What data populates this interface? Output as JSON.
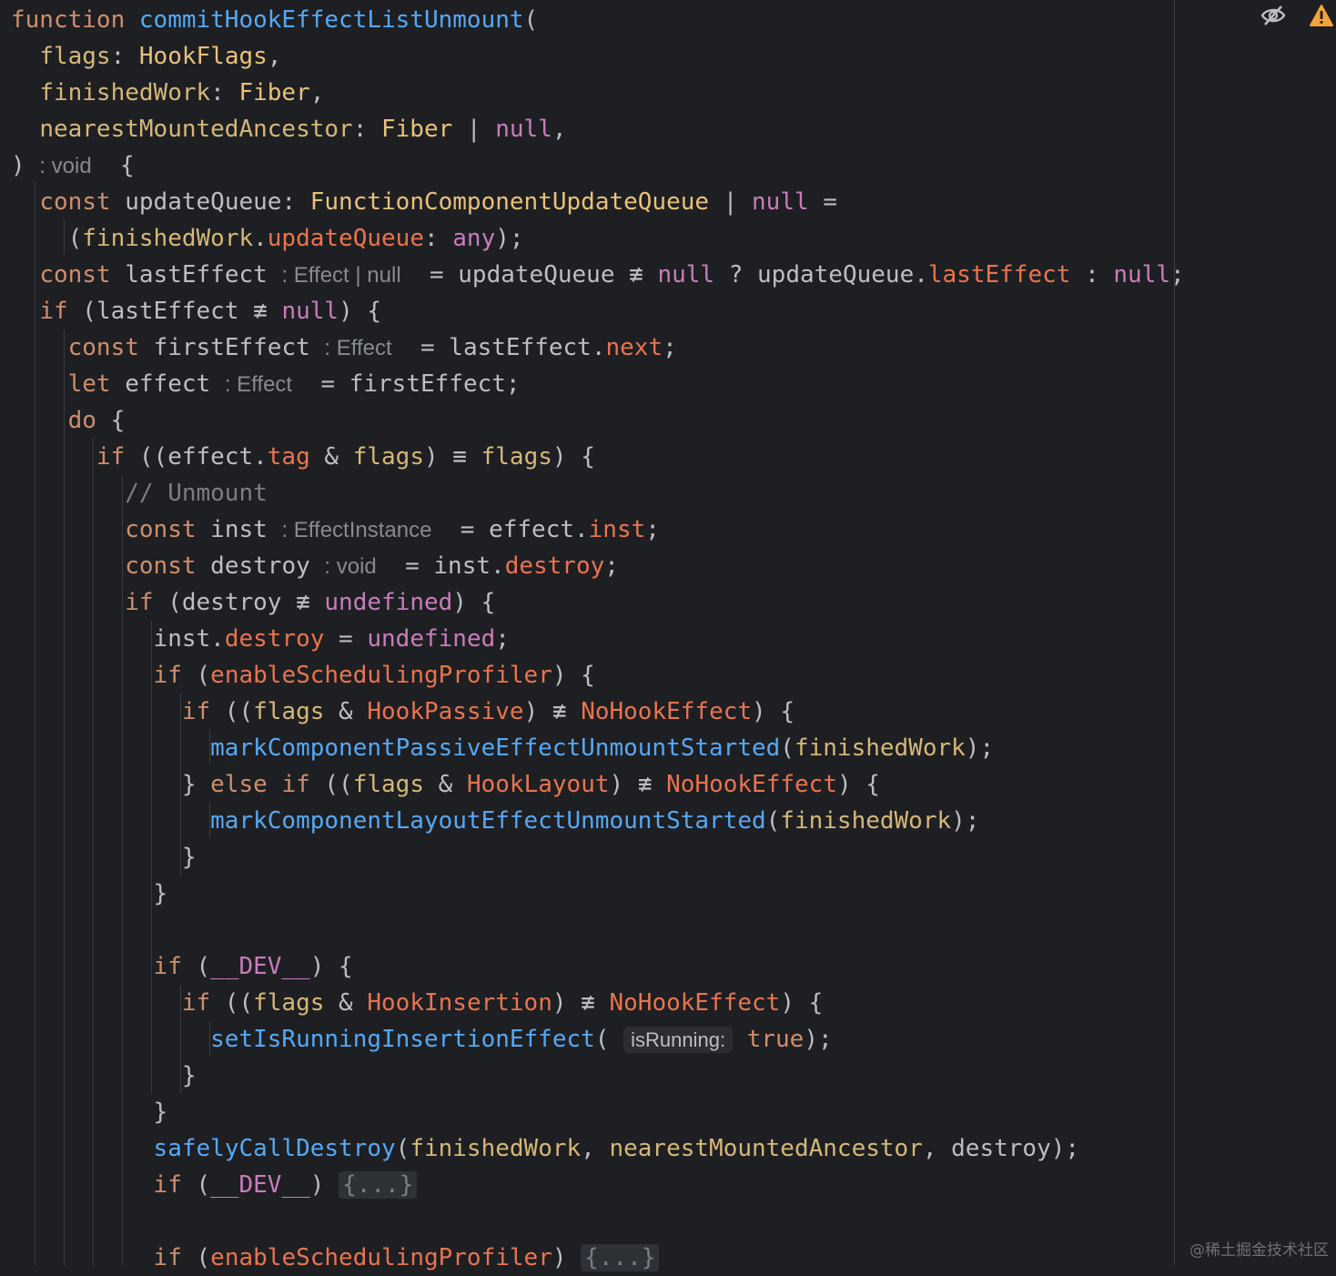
{
  "code": {
    "l1_kw": "function",
    "l1_fn": "commitHookEffectListUnmount",
    "l2_param": "flags",
    "l2_type": "HookFlags",
    "l3_param": "finishedWork",
    "l3_type": "Fiber",
    "l4_param": "nearestMountedAncestor",
    "l4_type": "Fiber",
    "null": "null",
    "void_hint": ": void",
    "const": "const",
    "let": "let",
    "if": "if",
    "do": "do",
    "else": "else",
    "any": "any",
    "updateQueue": "updateQueue",
    "updateQueue_type": "FunctionComponentUpdateQueue",
    "finishedWork": "finishedWork",
    "updateQueue_field": "updateQueue",
    "lastEffect": "lastEffect",
    "lastEffect_hint": ": Effect | null",
    "lastEffect_field": "lastEffect",
    "firstEffect": "firstEffect",
    "effect_hint": ": Effect",
    "next_field": "next",
    "effect": "effect",
    "tag_field": "tag",
    "flags": "flags",
    "comment": "// Unmount",
    "inst": "inst",
    "inst_hint": ": EffectInstance",
    "inst_field": "inst",
    "destroy": "destroy",
    "destroy_hint": ": void",
    "destroy_field": "destroy",
    "undefined": "undefined",
    "enableSchedulingProfiler": "enableSchedulingProfiler",
    "HookPassive": "HookPassive",
    "NoHookEffect": "NoHookEffect",
    "markPassive": "markComponentPassiveEffectUnmountStarted",
    "HookLayout": "HookLayout",
    "markLayout": "markComponentLayoutEffectUnmountStarted",
    "DEV": "__DEV__",
    "HookInsertion": "HookInsertion",
    "setIsRunning": "setIsRunningInsertionEffect",
    "isRunning_hint": "isRunning:",
    "true": "true",
    "safelyCallDestroy": "safelyCallDestroy",
    "nearestMountedAncestor": "nearestMountedAncestor",
    "fold": "{...}"
  },
  "icons": {
    "eye": "eye-slash-icon",
    "warning": "warning-icon"
  },
  "watermark": "@稀土掘金技术社区"
}
